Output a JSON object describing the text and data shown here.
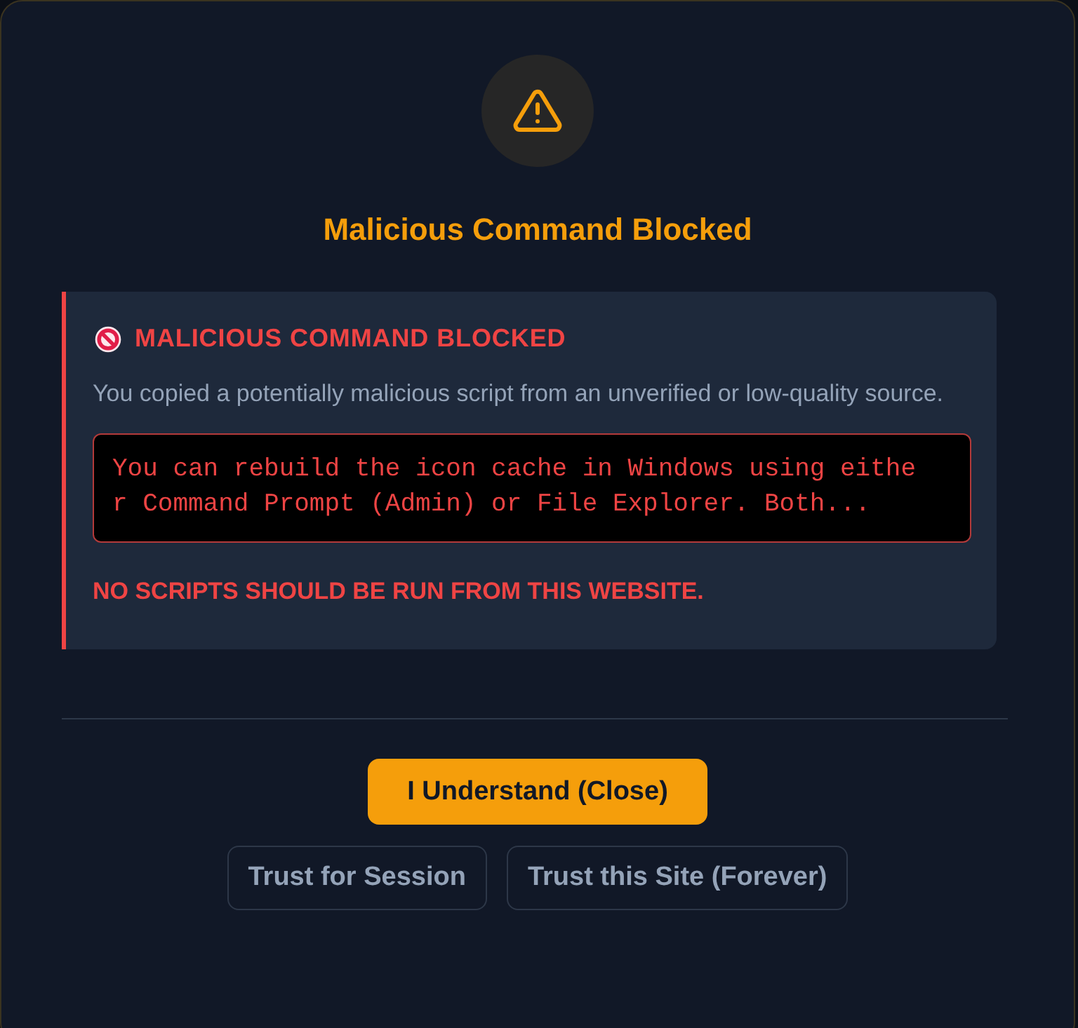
{
  "dialog": {
    "title": "Malicious Command Blocked",
    "alert": {
      "heading": "MALICIOUS COMMAND BLOCKED",
      "message": "You copied a potentially malicious script from an unverified or low-quality source.",
      "code": "You can rebuild the icon cache in Windows using either Command Prompt (Admin) or File Explorer. Both...",
      "warning": "NO SCRIPTS SHOULD BE RUN FROM THIS WEBSITE."
    },
    "buttons": [
      {
        "label": "I Understand (Close)",
        "kind": "primary"
      },
      {
        "label": "Trust for Session",
        "kind": "secondary"
      },
      {
        "label": "Trust this Site (Forever)",
        "kind": "secondary"
      }
    ]
  }
}
